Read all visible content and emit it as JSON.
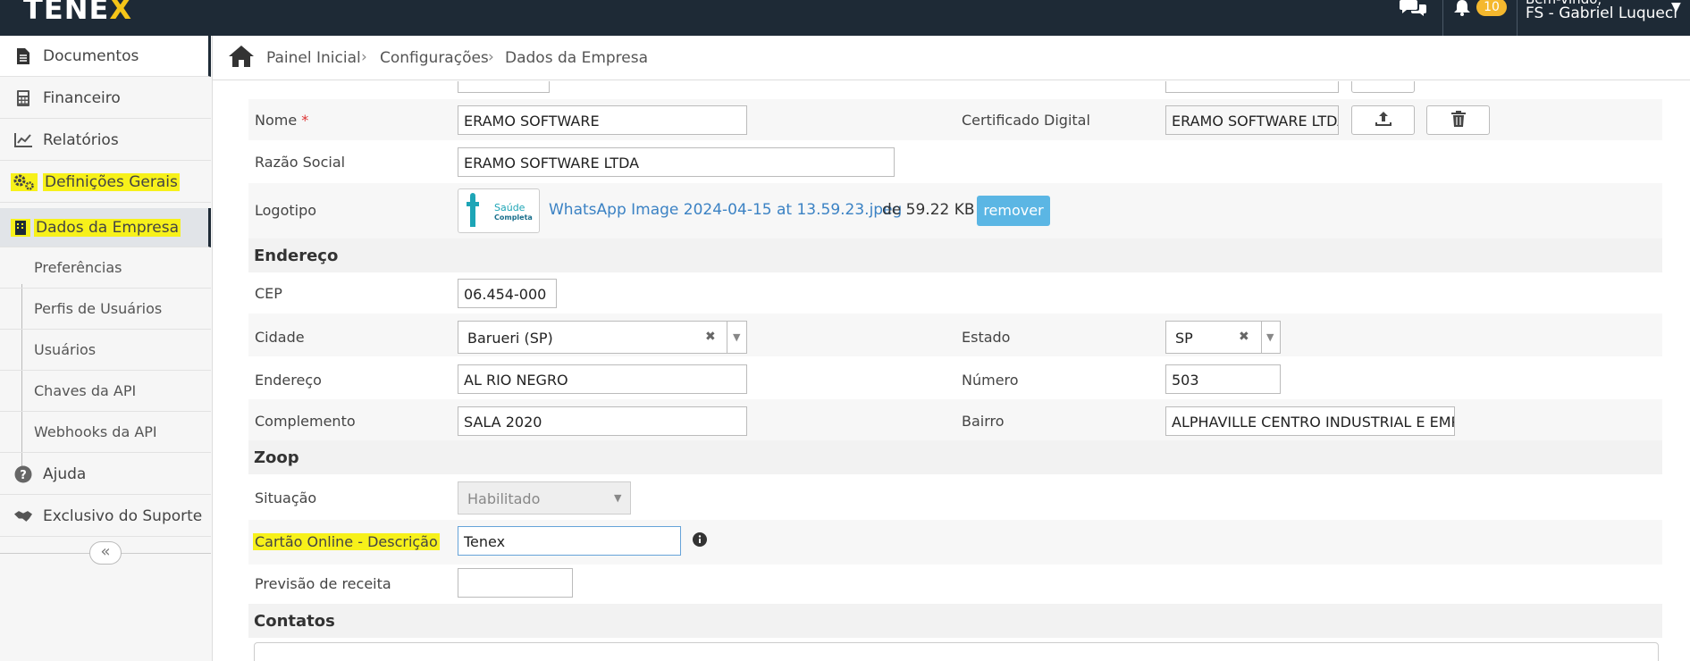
{
  "app": {
    "logo_left": "TENE",
    "logo_right": "X"
  },
  "topbar": {
    "notifications_count": "10",
    "user_line1": "Bem-vindo,",
    "user_line2": "FS - Gabriel Luqueci"
  },
  "sidebar": {
    "items": [
      {
        "label": "Documentos",
        "icon": "document-icon"
      },
      {
        "label": "Financeiro",
        "icon": "calculator-icon"
      },
      {
        "label": "Relatórios",
        "icon": "chart-line-icon"
      },
      {
        "label": "Definições Gerais",
        "icon": "gears-icon"
      },
      {
        "label": "Dados da Empresa",
        "icon": "building-icon"
      }
    ],
    "subitems": [
      "Preferências",
      "Perfis de Usuários",
      "Usuários",
      "Chaves da API",
      "Webhooks da API"
    ],
    "bottom_items": [
      {
        "label": "Ajuda",
        "icon": "question-icon"
      },
      {
        "label": "Exclusivo do Suporte",
        "icon": "handshake-icon"
      }
    ],
    "collapse_label": "«"
  },
  "breadcrumb": {
    "items": [
      "Painel Inicial",
      "Configurações",
      "Dados da Empresa"
    ],
    "separator": "›"
  },
  "form": {
    "nome_label": "Nome",
    "required_mark": "*",
    "nome_value": "ERAMO SOFTWARE",
    "certificado_label": "Certificado Digital",
    "certificado_value": "ERAMO SOFTWARE LTDA",
    "razao_label": "Razão Social",
    "razao_value": "ERAMO SOFTWARE LTDA",
    "logotipo_label": "Logotipo",
    "logo_file_name": "WhatsApp Image 2024-04-15 at 13.59.23.jpeg",
    "logo_file_size": "de 59.22 KB",
    "remove_label": "remover",
    "logo_brand_line1": "Saúde",
    "logo_brand_line2": "Completa",
    "endereco_section": "Endereço",
    "cep_label": "CEP",
    "cep_value": "06.454-000",
    "cidade_label": "Cidade",
    "cidade_value": "Barueri (SP)",
    "estado_label": "Estado",
    "estado_value": "SP",
    "endereco_label": "Endereço",
    "endereco_value": "AL RIO NEGRO",
    "numero_label": "Número",
    "numero_value": "503",
    "complemento_label": "Complemento",
    "complemento_value": "SALA 2020",
    "bairro_label": "Bairro",
    "bairro_value": "ALPHAVILLE CENTRO INDUSTRIAL E EMPRESARIAL",
    "zoop_section": "Zoop",
    "situacao_label": "Situação",
    "situacao_value": "Habilitado",
    "cartao_label": "Cartão Online - Descrição",
    "cartao_value": "Tenex",
    "previsao_label": "Previsão de receita",
    "previsao_value": "",
    "contatos_section": "Contatos"
  },
  "colors": {
    "topbar": "#1e2a36",
    "highlight": "#f7f11a",
    "link": "#3b82c4",
    "remove_button": "#5bb6e4",
    "badge": "#f5b82e"
  }
}
